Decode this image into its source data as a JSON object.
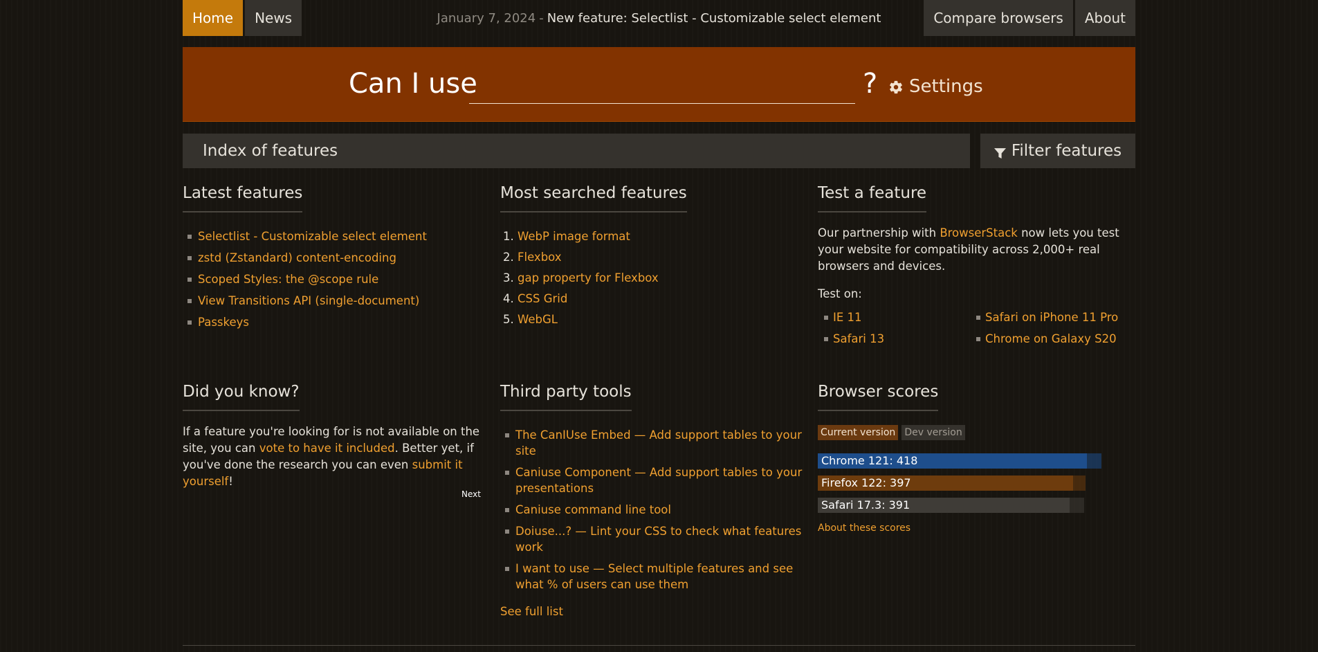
{
  "nav": {
    "home": "Home",
    "news": "News",
    "compare": "Compare browsers",
    "about": "About"
  },
  "announcement": {
    "date": "January 7, 2024",
    "separator": "-",
    "text": "New feature: Selectlist - Customizable select element"
  },
  "search": {
    "prefix": "Can I use",
    "value": "",
    "suffix": "?",
    "settings_label": "Settings",
    "settings_icon": "gear-icon"
  },
  "index_bar": {
    "title": "Index of features",
    "filter_label": "Filter features",
    "filter_icon": "funnel-icon"
  },
  "latest": {
    "title": "Latest features",
    "items": [
      "Selectlist - Customizable select element",
      "zstd (Zstandard) content-encoding",
      "Scoped Styles: the @scope rule",
      "View Transitions API (single-document)",
      "Passkeys"
    ]
  },
  "most_searched": {
    "title": "Most searched features",
    "items": [
      "WebP image format",
      "Flexbox",
      "gap property for Flexbox",
      "CSS Grid",
      "WebGL"
    ]
  },
  "test_feature": {
    "title": "Test a feature",
    "text_before": "Our partnership with ",
    "link": "BrowserStack",
    "text_after": " now lets you test your website for compatibility across 2,000+ real browsers and devices.",
    "test_on": "Test on:",
    "devices_left": [
      "IE 11",
      "Safari 13"
    ],
    "devices_right": [
      "Safari on iPhone 11 Pro",
      "Chrome on Galaxy S20"
    ]
  },
  "did_you_know": {
    "title": "Did you know?",
    "t1": "If a feature you're looking for is not available on the site, you can ",
    "link1": "vote to have it included",
    "t2": ". Better yet, if you've done the research you can even ",
    "link2": "submit it yourself",
    "t3": "!",
    "next": "Next"
  },
  "third_party": {
    "title": "Third party tools",
    "items": [
      "The CanIUse Embed — Add support tables to your site",
      "Caniuse Component — Add support tables to your presentations",
      "Caniuse command line tool",
      "Doiuse...? — Lint your CSS to check what features work",
      "I want to use — Select multiple features and see what % of users can use them"
    ],
    "see_full": "See full list"
  },
  "browser_scores": {
    "title": "Browser scores",
    "tab_current": "Current version",
    "tab_dev": "Dev version",
    "scores": [
      {
        "label": "Chrome 121: 418",
        "value": 418,
        "max": 441,
        "color": "#1e4e8c"
      },
      {
        "label": "Firefox 122: 397",
        "value": 397,
        "max": 416,
        "color": "#6e3c0d"
      },
      {
        "label": "Safari 17.3: 391",
        "value": 391,
        "max": 414,
        "color": "#3f3c37"
      }
    ],
    "about": "About these scores"
  }
}
